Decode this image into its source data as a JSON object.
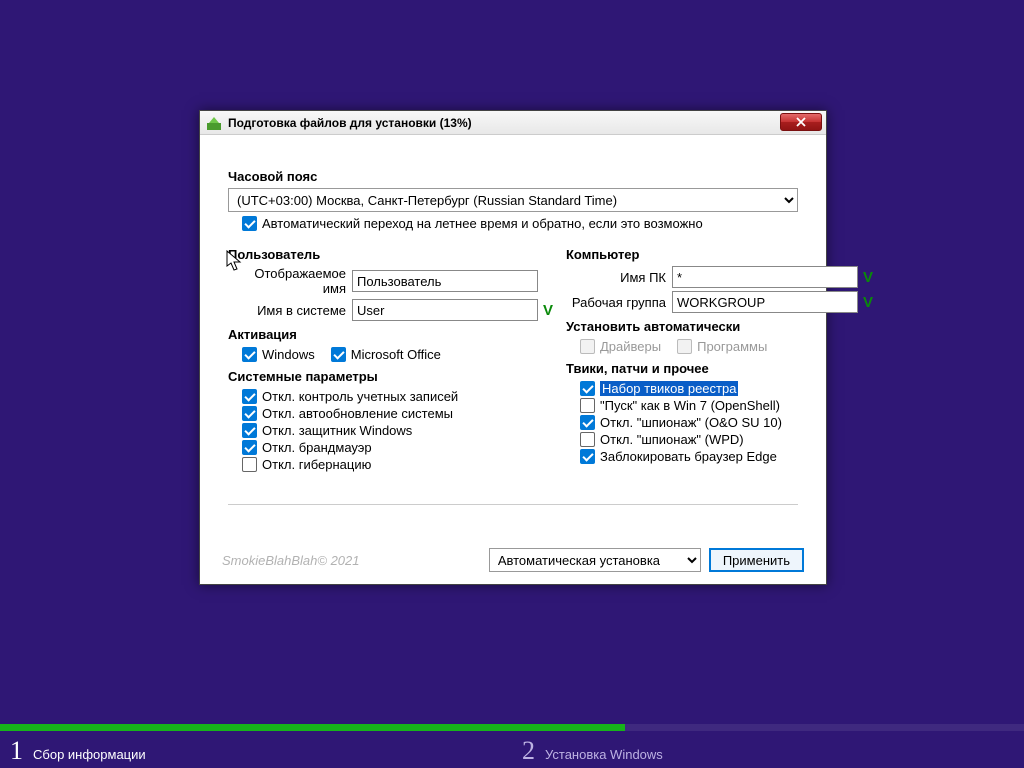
{
  "window": {
    "title": "Подготовка файлов для установки (13%)"
  },
  "timezone": {
    "section": "Часовой пояс",
    "value": "(UTC+03:00) Москва, Санкт-Петербург (Russian Standard Time)",
    "dst_label": "Автоматический переход на летнее время и обратно, если это возможно"
  },
  "user": {
    "section": "Пользователь",
    "display_label": "Отображаемое имя",
    "display_value": "Пользователь",
    "system_label": "Имя в системе",
    "system_value": "User"
  },
  "computer": {
    "section": "Компьютер",
    "pcname_label": "Имя ПК",
    "pcname_value": "*",
    "workgroup_label": "Рабочая группа",
    "workgroup_value": "WORKGROUP"
  },
  "activation": {
    "section": "Активация",
    "windows": "Windows",
    "office": "Microsoft Office"
  },
  "autoinstall": {
    "section": "Установить автоматически",
    "drivers": "Драйверы",
    "programs": "Программы"
  },
  "sysparams": {
    "section": "Системные параметры",
    "uac": "Откл. контроль учетных записей",
    "autoupdate": "Откл. автообновление системы",
    "defender": "Откл. защитник Windows",
    "firewall": "Откл. брандмауэр",
    "hibernate": "Откл. гибернацию"
  },
  "tweaks": {
    "section": "Твики, патчи и прочее",
    "registry": "Набор твиков реестра",
    "openshell": "\"Пуск\" как в Win 7 (OpenShell)",
    "spy_oo": "Откл. \"шпионаж\" (O&O SU 10)",
    "spy_wpd": "Откл. \"шпионаж\" (WPD)",
    "edge": "Заблокировать браузер Edge"
  },
  "footer": {
    "copyright": "SmokieBlahBlah© 2021",
    "mode": "Автоматическая установка",
    "apply": "Применить"
  },
  "steps": {
    "one": "Сбор информации",
    "two": "Установка Windows"
  },
  "valid_mark": "V"
}
